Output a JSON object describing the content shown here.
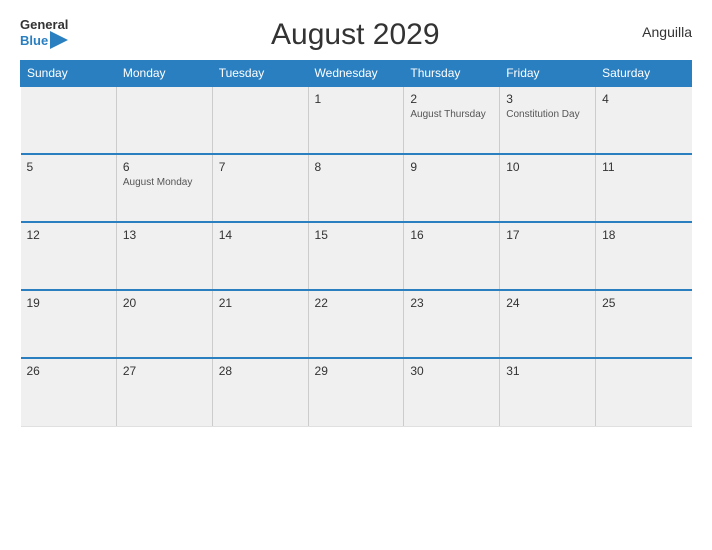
{
  "logo": {
    "general": "General",
    "blue": "Blue",
    "icon": "▶"
  },
  "title": "August 2029",
  "country": "Anguilla",
  "weekdays": [
    "Sunday",
    "Monday",
    "Tuesday",
    "Wednesday",
    "Thursday",
    "Friday",
    "Saturday"
  ],
  "weeks": [
    [
      {
        "day": "",
        "event": ""
      },
      {
        "day": "",
        "event": ""
      },
      {
        "day": "",
        "event": ""
      },
      {
        "day": "1",
        "event": ""
      },
      {
        "day": "2",
        "event": "August Thursday"
      },
      {
        "day": "3",
        "event": "Constitution Day"
      },
      {
        "day": "4",
        "event": ""
      }
    ],
    [
      {
        "day": "5",
        "event": ""
      },
      {
        "day": "6",
        "event": "August Monday"
      },
      {
        "day": "7",
        "event": ""
      },
      {
        "day": "8",
        "event": ""
      },
      {
        "day": "9",
        "event": ""
      },
      {
        "day": "10",
        "event": ""
      },
      {
        "day": "11",
        "event": ""
      }
    ],
    [
      {
        "day": "12",
        "event": ""
      },
      {
        "day": "13",
        "event": ""
      },
      {
        "day": "14",
        "event": ""
      },
      {
        "day": "15",
        "event": ""
      },
      {
        "day": "16",
        "event": ""
      },
      {
        "day": "17",
        "event": ""
      },
      {
        "day": "18",
        "event": ""
      }
    ],
    [
      {
        "day": "19",
        "event": ""
      },
      {
        "day": "20",
        "event": ""
      },
      {
        "day": "21",
        "event": ""
      },
      {
        "day": "22",
        "event": ""
      },
      {
        "day": "23",
        "event": ""
      },
      {
        "day": "24",
        "event": ""
      },
      {
        "day": "25",
        "event": ""
      }
    ],
    [
      {
        "day": "26",
        "event": ""
      },
      {
        "day": "27",
        "event": ""
      },
      {
        "day": "28",
        "event": ""
      },
      {
        "day": "29",
        "event": ""
      },
      {
        "day": "30",
        "event": ""
      },
      {
        "day": "31",
        "event": ""
      },
      {
        "day": "",
        "event": ""
      }
    ]
  ]
}
